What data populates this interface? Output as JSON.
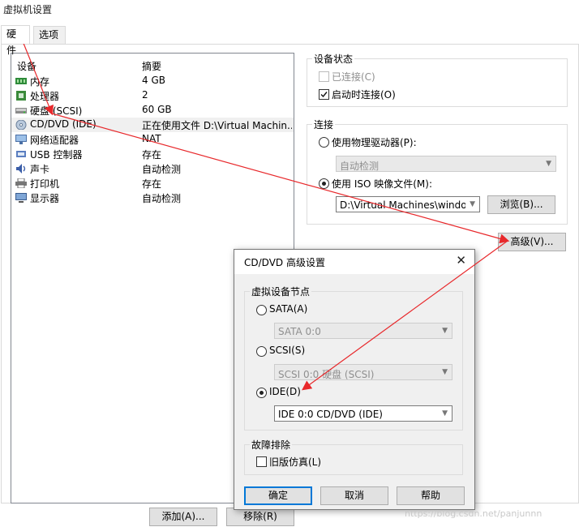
{
  "window": {
    "title": "虚拟机设置"
  },
  "tabs": [
    {
      "label": "硬件",
      "active": true
    },
    {
      "label": "选项",
      "active": false
    }
  ],
  "device_list": {
    "header_device": "设备",
    "header_summary": "摘要",
    "rows": [
      {
        "name": "内存",
        "summary": "4 GB",
        "icon": "memory-icon"
      },
      {
        "name": "处理器",
        "summary": "2",
        "icon": "cpu-icon"
      },
      {
        "name": "硬盘 (SCSI)",
        "summary": "60 GB",
        "icon": "harddisk-icon"
      },
      {
        "name": "CD/DVD (IDE)",
        "summary": "正在使用文件 D:\\Virtual Machin...",
        "icon": "cd-dvd-icon",
        "selected": true
      },
      {
        "name": "网络适配器",
        "summary": "NAT",
        "icon": "network-icon"
      },
      {
        "name": "USB 控制器",
        "summary": "存在",
        "icon": "usb-icon"
      },
      {
        "name": "声卡",
        "summary": "自动检测",
        "icon": "sound-icon"
      },
      {
        "name": "打印机",
        "summary": "存在",
        "icon": "printer-icon"
      },
      {
        "name": "显示器",
        "summary": "自动检测",
        "icon": "display-icon"
      }
    ]
  },
  "device_status": {
    "label": "设备状态",
    "connected": "已连接(C)",
    "connect_on_poweron": "启动时连接(O)"
  },
  "connection": {
    "label": "连接",
    "use_physical": "使用物理驱动器(P):",
    "physical_value": "自动检测",
    "use_iso": "使用 ISO 映像文件(M):",
    "iso_path": "D:\\Virtual Machines\\windows",
    "browse": "浏览(B)..."
  },
  "advanced_button": "高级(V)...",
  "bottom_buttons": {
    "add": "添加(A)...",
    "remove": "移除(R)"
  },
  "dialog": {
    "title": "CD/DVD 高级设置",
    "close_glyph": "✕",
    "node_group": "虚拟设备节点",
    "sata_label": "SATA(A)",
    "sata_value": "SATA 0:0",
    "scsi_label": "SCSI(S)",
    "scsi_value": "SCSI 0:0   硬盘 (SCSI)",
    "ide_label": "IDE(D)",
    "ide_value": "IDE 0:0   CD/DVD (IDE)",
    "troubleshoot_group": "故障排除",
    "legacy_emulation": "旧版仿真(L)",
    "ok": "确定",
    "cancel": "取消",
    "help": "帮助"
  },
  "watermark": "https://blog.csdn.net/panjunnn",
  "colors": {
    "arrow": "#e8282b",
    "focus": "#0078d7",
    "selected_row": "#f0f0f0"
  }
}
